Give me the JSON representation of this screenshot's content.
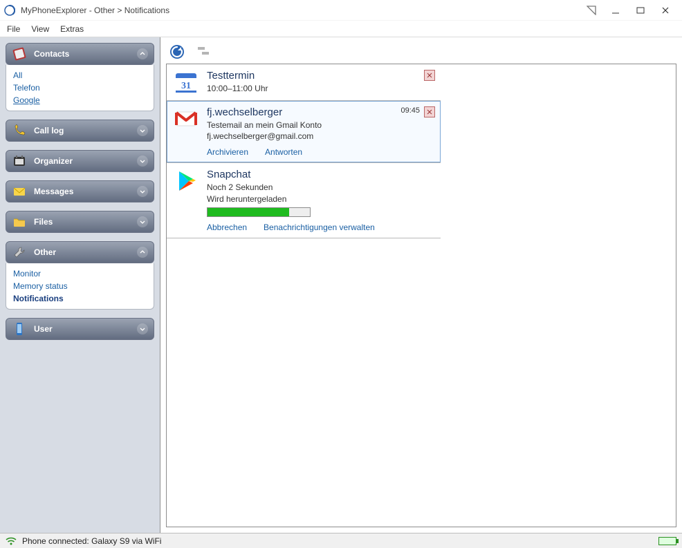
{
  "window": {
    "title": "MyPhoneExplorer -  Other > Notifications"
  },
  "menu": {
    "file": "File",
    "view": "View",
    "extras": "Extras"
  },
  "sidebar": {
    "contacts": {
      "label": "Contacts",
      "items": [
        "All",
        "Telefon",
        "Google"
      ]
    },
    "calllog": {
      "label": "Call log"
    },
    "organizer": {
      "label": "Organizer"
    },
    "messages": {
      "label": "Messages"
    },
    "files": {
      "label": "Files"
    },
    "other": {
      "label": "Other",
      "items": [
        "Monitor",
        "Memory status",
        "Notifications"
      ],
      "active_index": 2
    },
    "user": {
      "label": "User"
    }
  },
  "notifications": [
    {
      "title": "Testtermin",
      "line1": "10:00–11:00 Uhr",
      "line2": "",
      "time": "",
      "icon": "calendar",
      "actions": []
    },
    {
      "title": "fj.wechselberger",
      "line1": "Testemail an mein Gmail Konto",
      "line2": "fj.wechselberger@gmail.com",
      "time": "09:45",
      "icon": "gmail",
      "actions": [
        "Archivieren",
        "Antworten"
      ],
      "active": true
    },
    {
      "title": "Snapchat",
      "line1": "Noch 2 Sekunden",
      "line2": "Wird heruntergeladen",
      "time": "",
      "icon": "play",
      "progress": 0.8,
      "actions": [
        "Abbrechen",
        "Benachrichtigungen verwalten"
      ]
    }
  ],
  "status": {
    "text": "Phone connected: Galaxy S9 via WiFi"
  }
}
